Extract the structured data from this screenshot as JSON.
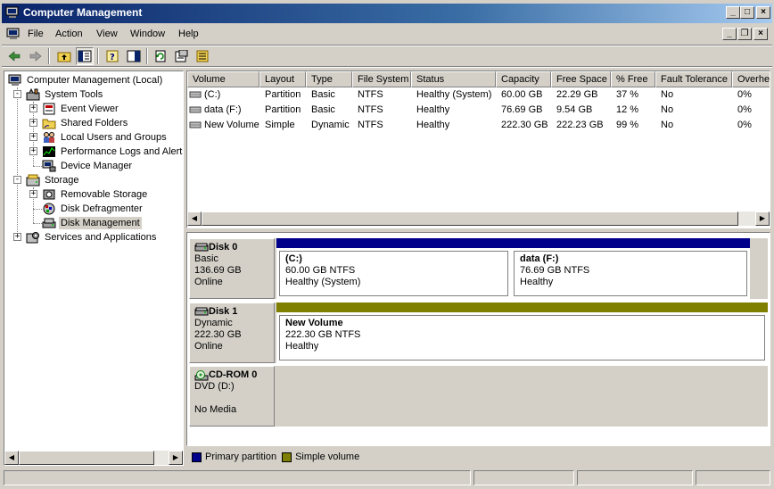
{
  "window": {
    "title": "Computer Management",
    "min": "_",
    "max": "□",
    "close": "×"
  },
  "menu": [
    "File",
    "Action",
    "View",
    "Window",
    "Help"
  ],
  "colors": {
    "primary_partition": "#00008b",
    "simple_volume": "#808000",
    "selection": "#d4d0c8"
  },
  "tree": {
    "root": "Computer Management (Local)",
    "items": [
      {
        "label": "System Tools",
        "icon": "tools-icon",
        "expander": "-"
      },
      {
        "label": "Event Viewer",
        "icon": "event-viewer-icon",
        "expander": "+"
      },
      {
        "label": "Shared Folders",
        "icon": "folder-icon",
        "expander": "+"
      },
      {
        "label": "Local Users and Groups",
        "icon": "users-icon",
        "expander": "+"
      },
      {
        "label": "Performance Logs and Alerts",
        "icon": "performance-icon",
        "expander": "+"
      },
      {
        "label": "Device Manager",
        "icon": "device-manager-icon",
        "expander": ""
      },
      {
        "label": "Storage",
        "icon": "storage-icon",
        "expander": "-"
      },
      {
        "label": "Removable Storage",
        "icon": "removable-storage-icon",
        "expander": "+"
      },
      {
        "label": "Disk Defragmenter",
        "icon": "defrag-icon",
        "expander": ""
      },
      {
        "label": "Disk Management",
        "icon": "disk-management-icon",
        "expander": ""
      },
      {
        "label": "Services and Applications",
        "icon": "services-icon",
        "expander": "+"
      }
    ]
  },
  "volumes": {
    "columns": [
      "Volume",
      "Layout",
      "Type",
      "File System",
      "Status",
      "Capacity",
      "Free Space",
      "% Free",
      "Fault Tolerance",
      "Overhead"
    ],
    "rows": [
      [
        "(C:)",
        "Partition",
        "Basic",
        "NTFS",
        "Healthy (System)",
        "60.00 GB",
        "22.29 GB",
        "37 %",
        "No",
        "0%"
      ],
      [
        "data (F:)",
        "Partition",
        "Basic",
        "NTFS",
        "Healthy",
        "76.69 GB",
        "9.54 GB",
        "12 %",
        "No",
        "0%"
      ],
      [
        "New Volume",
        "Simple",
        "Dynamic",
        "NTFS",
        "Healthy",
        "222.30 GB",
        "222.23 GB",
        "99 %",
        "No",
        "0%"
      ]
    ]
  },
  "disks": [
    {
      "name": "Disk 0",
      "type": "Basic",
      "size": "136.69 GB",
      "state": "Online",
      "partitions": [
        {
          "name": "(C:)",
          "size": "60.00 GB NTFS",
          "status": "Healthy (System)",
          "kind": "primary"
        },
        {
          "name": "data  (F:)",
          "size": "76.69 GB NTFS",
          "status": "Healthy",
          "kind": "primary"
        }
      ]
    },
    {
      "name": "Disk 1",
      "type": "Dynamic",
      "size": "222.30 GB",
      "state": "Online",
      "partitions": [
        {
          "name": "New Volume",
          "size": "222.30 GB NTFS",
          "status": "Healthy",
          "kind": "simple"
        }
      ]
    },
    {
      "name": "CD-ROM 0",
      "type": "DVD (D:)",
      "size": "",
      "state": "No Media",
      "partitions": []
    }
  ],
  "legend": {
    "primary": "Primary partition",
    "simple": "Simple volume"
  }
}
